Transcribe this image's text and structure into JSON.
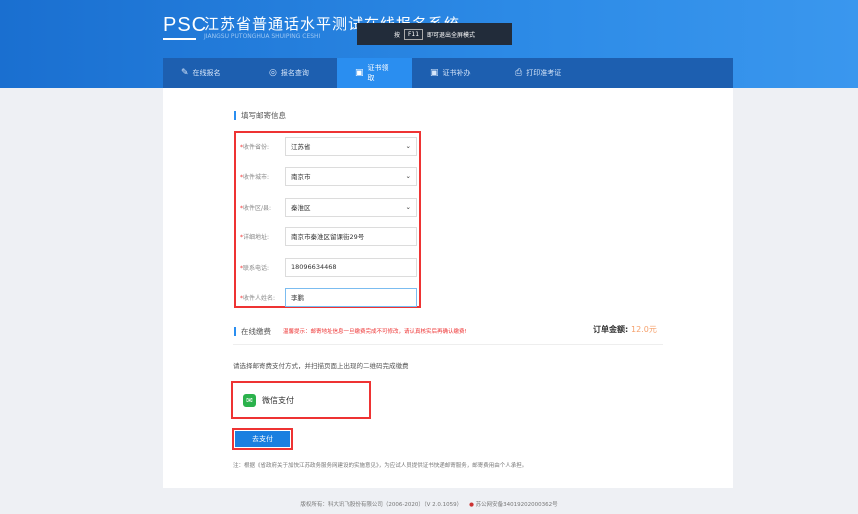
{
  "header": {
    "logo": "PSC",
    "title": "江苏省普通话水平测试在线报名系统",
    "subtitle": "JIANGSU PUTONGHUA SHUIPING CESHI"
  },
  "toast": {
    "prefix": "按",
    "key": "F11",
    "suffix": "即可退出全屏模式"
  },
  "nav": [
    {
      "label": "在线报名",
      "icon": "✎"
    },
    {
      "label": "报名查询",
      "icon": "◎"
    },
    {
      "label": "证书领取",
      "icon": "▣"
    },
    {
      "label": "证书补办",
      "icon": "▣"
    },
    {
      "label": "打印准考证",
      "icon": "⎙"
    }
  ],
  "mail": {
    "section_title": "填写邮寄信息",
    "fields": [
      {
        "label": "收件省份:",
        "value": "江苏省",
        "type": "select"
      },
      {
        "label": "收件城市:",
        "value": "南京市",
        "type": "select"
      },
      {
        "label": "收件区/县:",
        "value": "秦淮区",
        "type": "select"
      },
      {
        "label": "详细地址:",
        "value": "南京市秦淮区留课街29号",
        "type": "input"
      },
      {
        "label": "联系电话:",
        "value": "18096634468",
        "type": "input"
      },
      {
        "label": "收件人姓名:",
        "value": "李鹏",
        "type": "input"
      }
    ]
  },
  "payment": {
    "section_title": "在线缴费",
    "hint": "温馨提示：邮寄地址信息一旦缴费完成不可修改，请认真核实后再确认缴费!",
    "amount_label": "订单金额:",
    "amount": "12.0元",
    "instruction": "请选择邮寄费支付方式，并扫描页面上出现的二维码完成缴费",
    "method": "微信支付",
    "pay_button": "去支付",
    "note": "注：根据《省政府关于加快江苏政务服务网建设的实施意见》，为应试人员提供证书快递邮寄服务，邮寄费用由个人承担。"
  },
  "footer": {
    "copyright": "版权所有：科大讯飞股份有限公司（2006-2020）（V 2.0.1059）",
    "icp": "苏公网安备34019202000362号"
  }
}
